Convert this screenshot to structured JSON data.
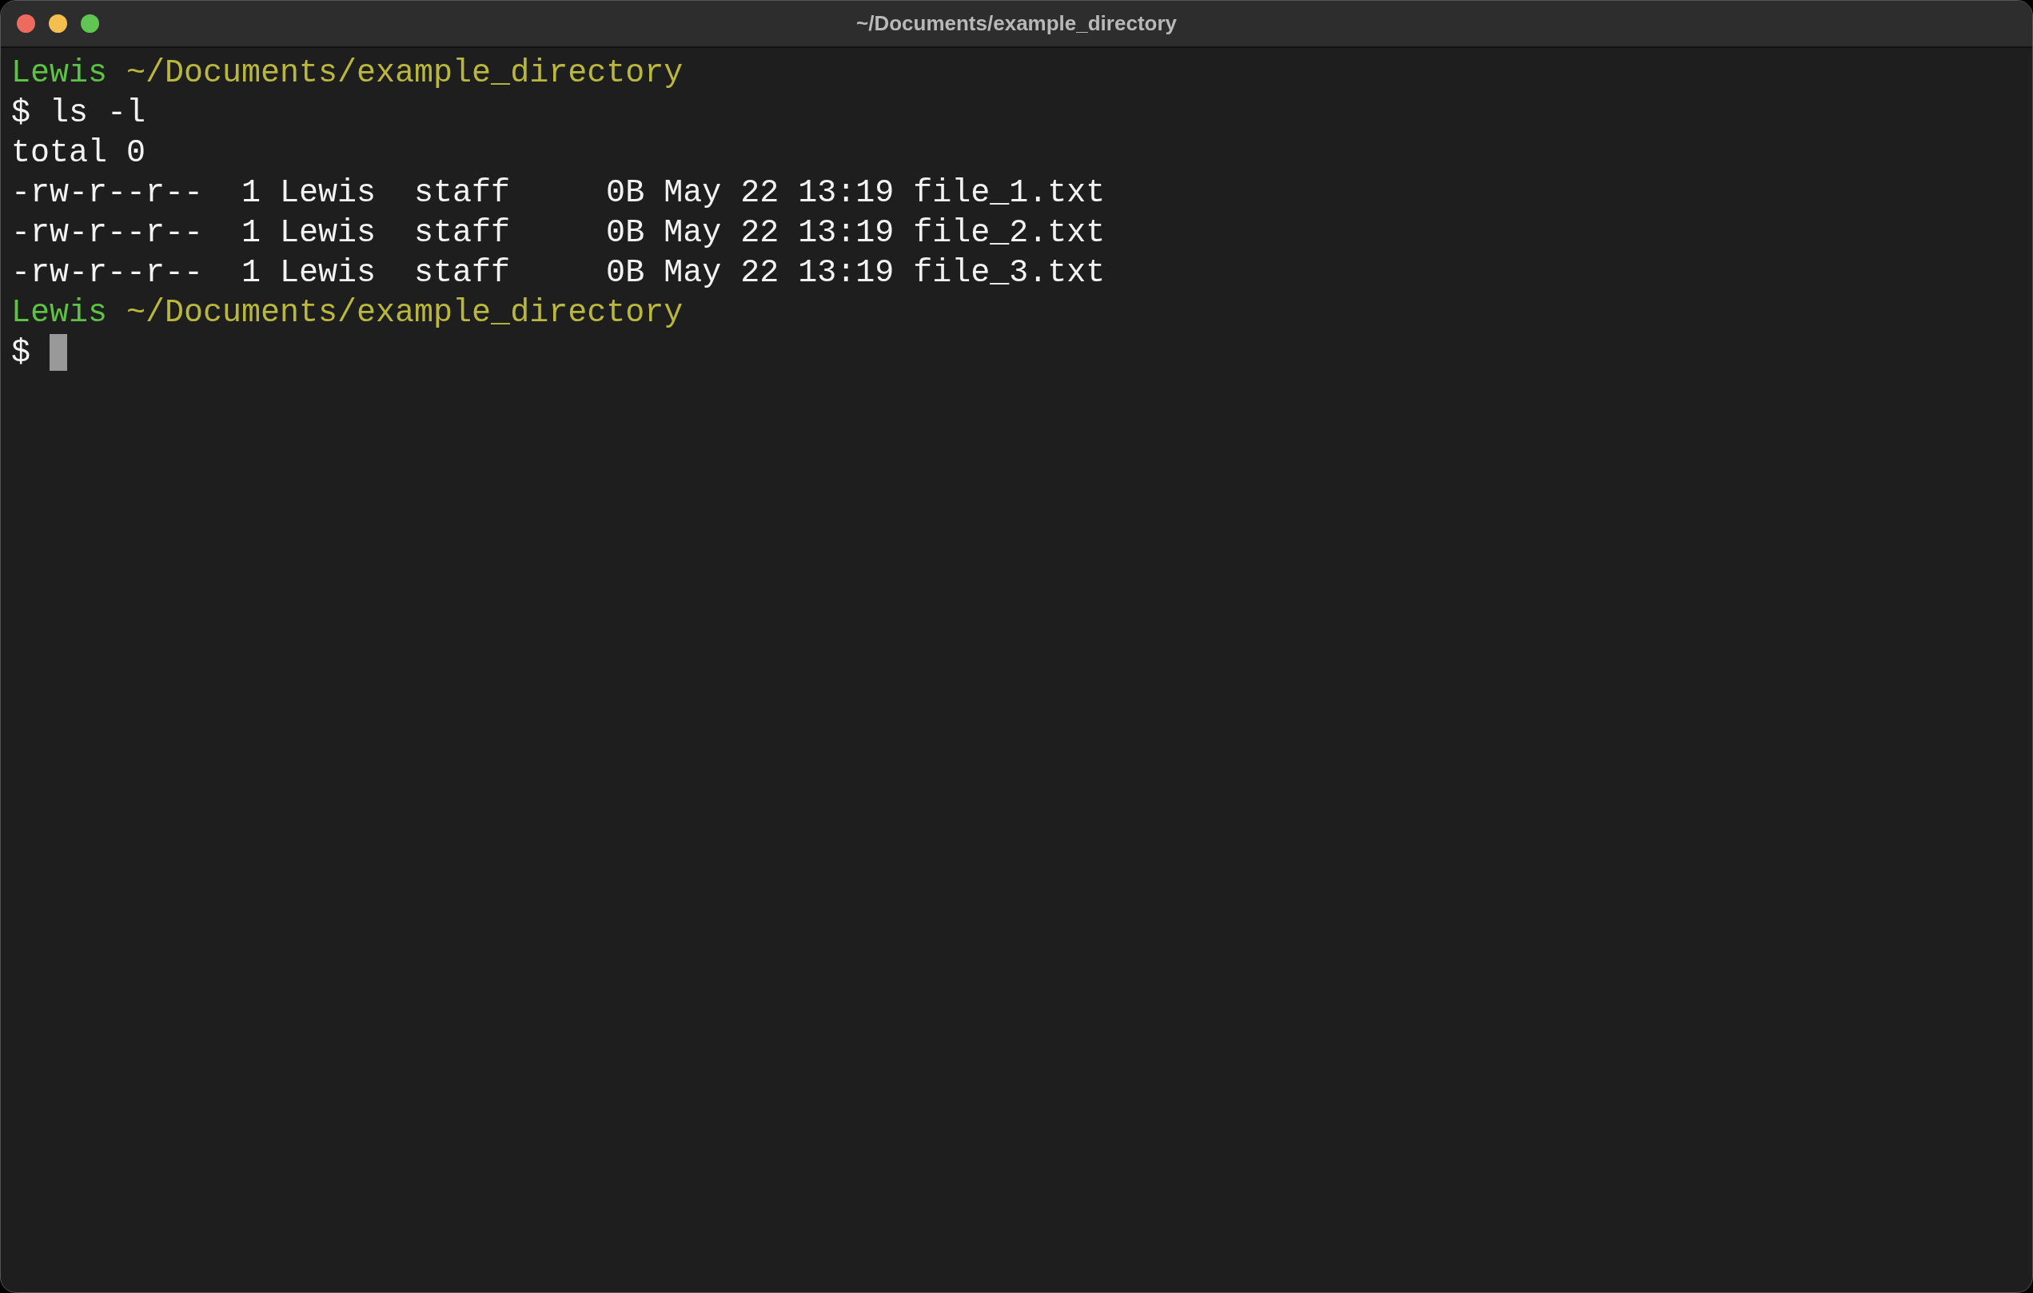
{
  "window": {
    "title": "~/Documents/example_directory"
  },
  "lines": [
    {
      "kind": "prompt",
      "user": "Lewis",
      "path": "~/Documents/example_directory"
    },
    {
      "kind": "command",
      "text": "$ ls -l"
    },
    {
      "kind": "output",
      "text": "total 0"
    },
    {
      "kind": "output",
      "text": "-rw-r--r--  1 Lewis  staff     0B May 22 13:19 file_1.txt"
    },
    {
      "kind": "output",
      "text": "-rw-r--r--  1 Lewis  staff     0B May 22 13:19 file_2.txt"
    },
    {
      "kind": "output",
      "text": "-rw-r--r--  1 Lewis  staff     0B May 22 13:19 file_3.txt"
    },
    {
      "kind": "prompt",
      "user": "Lewis",
      "path": "~/Documents/example_directory"
    },
    {
      "kind": "input",
      "text": "$"
    }
  ]
}
